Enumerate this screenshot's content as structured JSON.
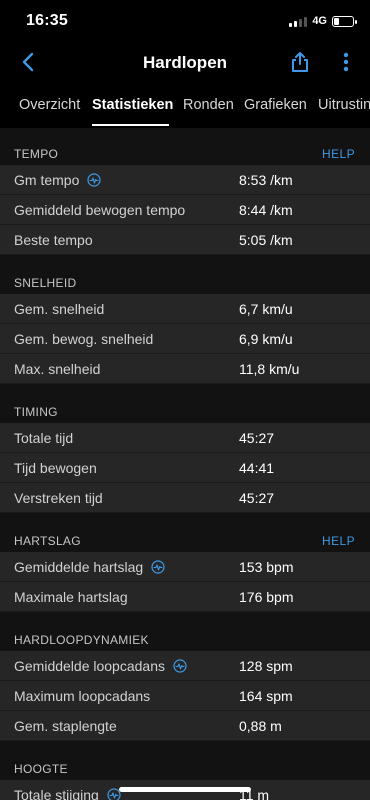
{
  "status_bar": {
    "time": "16:35",
    "network": "4G"
  },
  "nav": {
    "title": "Hardlopen"
  },
  "tabs": [
    {
      "label": "Overzicht",
      "active": false
    },
    {
      "label": "Statistieken",
      "active": true
    },
    {
      "label": "Ronden",
      "active": false
    },
    {
      "label": "Grafieken",
      "active": false
    },
    {
      "label": "Uitrusting",
      "active": false
    }
  ],
  "sections": [
    {
      "title": "TEMPO",
      "help": "HELP",
      "rows": [
        {
          "label": "Gm tempo",
          "value": "8:53 /km",
          "icon": "pulse-info-icon"
        },
        {
          "label": "Gemiddeld bewogen tempo",
          "value": "8:44 /km"
        },
        {
          "label": "Beste tempo",
          "value": "5:05 /km"
        }
      ]
    },
    {
      "title": "SNELHEID",
      "rows": [
        {
          "label": "Gem. snelheid",
          "value": "6,7 km/u"
        },
        {
          "label": "Gem. bewog. snelheid",
          "value": "6,9 km/u"
        },
        {
          "label": "Max. snelheid",
          "value": "11,8 km/u"
        }
      ]
    },
    {
      "title": "TIMING",
      "rows": [
        {
          "label": "Totale tijd",
          "value": "45:27"
        },
        {
          "label": "Tijd bewogen",
          "value": "44:41"
        },
        {
          "label": "Verstreken tijd",
          "value": "45:27"
        }
      ]
    },
    {
      "title": "HARTSLAG",
      "help": "HELP",
      "rows": [
        {
          "label": "Gemiddelde hartslag",
          "value": "153 bpm",
          "icon": "pulse-info-icon"
        },
        {
          "label": "Maximale hartslag",
          "value": "176 bpm"
        }
      ]
    },
    {
      "title": "HARDLOOPDYNAMIEK",
      "rows": [
        {
          "label": "Gemiddelde loopcadans",
          "value": "128 spm",
          "icon": "pulse-info-icon"
        },
        {
          "label": "Maximum loopcadans",
          "value": "164 spm"
        },
        {
          "label": "Gem. staplengte",
          "value": "0,88 m"
        }
      ]
    },
    {
      "title": "HOOGTE",
      "rows": [
        {
          "label": "Totale stijging",
          "value": "11 m",
          "icon": "pulse-info-icon"
        }
      ]
    }
  ],
  "colors": {
    "accent": "#3e9ae6",
    "row_bg": "#262626",
    "section_bg": "#121212"
  }
}
